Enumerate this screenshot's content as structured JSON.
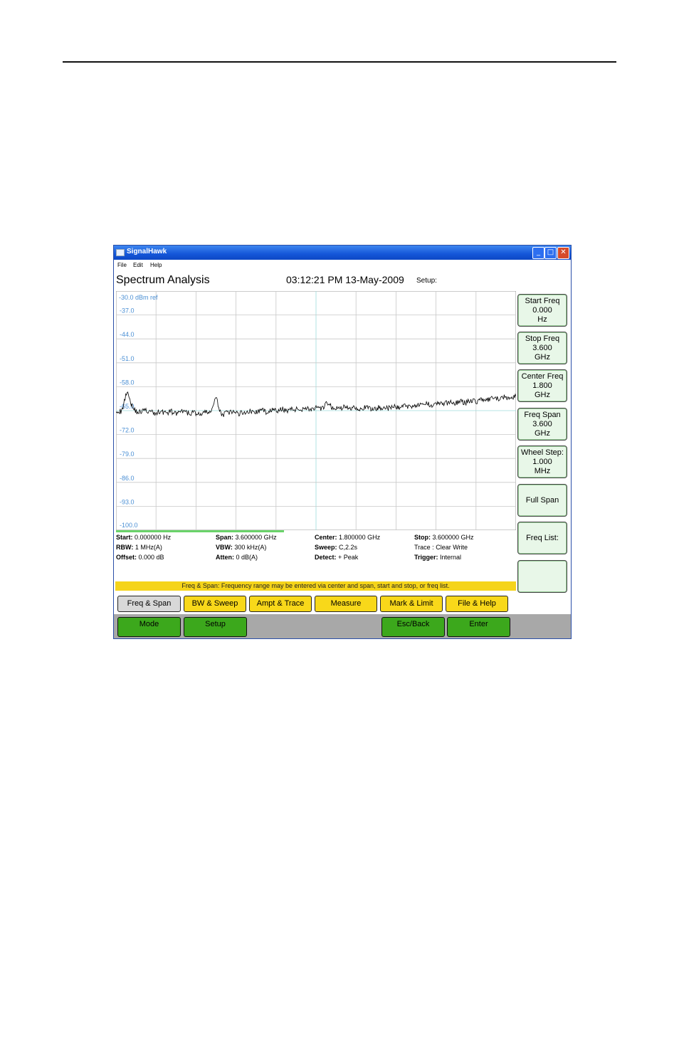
{
  "window": {
    "title": "SignalHawk",
    "controls": {
      "minimize": "_",
      "maximize": "□",
      "close": "✕"
    }
  },
  "menu": {
    "file": "File",
    "edit": "Edit",
    "help": "Help"
  },
  "header": {
    "title": "Spectrum Analysis",
    "datetime": "03:12:21 PM 13-May-2009",
    "setup_label": "Setup:"
  },
  "chart_data": {
    "type": "line",
    "title": "",
    "ref_label": "-30.0 dBm ref",
    "y_tick_labels": [
      "-37.0",
      "-44.0",
      "-51.0",
      "-58.0",
      "-65.0",
      "-72.0",
      "-79.0",
      "-86.0",
      "-93.0",
      "-100.0"
    ],
    "ylim": [
      -100,
      -30
    ],
    "xlim": [
      0,
      3.6
    ],
    "x_unit": "GHz",
    "y_unit": "dBm",
    "grid": true,
    "series": [
      {
        "x": [
          0.0,
          0.05,
          0.1,
          0.15,
          0.2,
          0.25,
          0.3,
          0.35,
          0.4,
          0.45,
          0.5,
          0.55,
          0.6,
          0.65,
          0.7,
          0.75,
          0.8,
          0.85,
          0.9,
          0.95,
          1.0,
          1.05,
          1.1,
          1.15,
          1.2,
          1.25,
          1.3,
          1.35,
          1.4,
          1.45,
          1.5,
          1.55,
          1.6,
          1.65,
          1.7,
          1.75,
          1.8,
          1.85,
          1.9,
          1.95,
          2.0,
          2.05,
          2.1,
          2.15,
          2.2,
          2.25,
          2.3,
          2.35,
          2.4,
          2.45,
          2.5,
          2.55,
          2.6,
          2.65,
          2.7,
          2.75,
          2.8,
          2.85,
          2.9,
          2.95,
          3.0,
          3.05,
          3.1,
          3.15,
          3.2,
          3.25,
          3.3,
          3.35,
          3.4,
          3.45,
          3.5,
          3.55,
          3.6
        ],
        "y": [
          -64.8,
          -65.4,
          -59.0,
          -64.2,
          -65.6,
          -64.9,
          -65.2,
          -65.9,
          -65.1,
          -65.7,
          -65.3,
          -66.0,
          -65.2,
          -65.8,
          -65.5,
          -66.2,
          -65.6,
          -65.4,
          -61.4,
          -66.3,
          -65.7,
          -65.4,
          -65.9,
          -65.5,
          -65.1,
          -65.6,
          -64.9,
          -65.3,
          -64.8,
          -65.2,
          -64.6,
          -64.9,
          -64.5,
          -64.8,
          -64.1,
          -64.6,
          -64.3,
          -64.7,
          -62.8,
          -64.2,
          -64.4,
          -64.0,
          -64.3,
          -63.9,
          -64.5,
          -64.1,
          -64.6,
          -64.2,
          -64.0,
          -64.4,
          -63.8,
          -64.1,
          -63.5,
          -63.9,
          -63.2,
          -63.6,
          -63.0,
          -63.3,
          -62.7,
          -63.1,
          -62.5,
          -62.8,
          -62.3,
          -62.6,
          -62.0,
          -62.3,
          -61.6,
          -62.0,
          -61.3,
          -61.7,
          -61.0,
          -61.4,
          -60.8
        ]
      }
    ]
  },
  "side_buttons": [
    {
      "line1": "Start Freq",
      "line2": "0.000",
      "line3": "Hz"
    },
    {
      "line1": "Stop Freq",
      "line2": "3.600",
      "line3": "GHz"
    },
    {
      "line1": "Center Freq",
      "line2": "1.800",
      "line3": "GHz"
    },
    {
      "line1": "Freq Span",
      "line2": "3.600",
      "line3": "GHz"
    },
    {
      "line1": "Wheel Step:",
      "line2": "1.000",
      "line3": "MHz"
    },
    {
      "line1": "Full Span"
    },
    {
      "line1": "Freq List:"
    },
    {
      "line1": ""
    }
  ],
  "sweep_progress": 0.42,
  "info": {
    "start_label": "Start:",
    "start_value": "0.000000 Hz",
    "span_label": "Span:",
    "span_value": "3.600000 GHz",
    "center_label": "Center:",
    "center_value": "1.800000 GHz",
    "stop_label": "Stop:",
    "stop_value": "3.600000 GHz",
    "rbw_label": "RBW:",
    "rbw_value": "1 MHz(A)",
    "vbw_label": "VBW:",
    "vbw_value": "300 kHz(A)",
    "sweep_label": "Sweep:",
    "sweep_value": "C,2.2s",
    "trace_label": "Trace :",
    "trace_value": "Clear Write",
    "offset_label": "Offset:",
    "offset_value": "0.000 dB",
    "atten_label": "Atten:",
    "atten_value": "0 dB(A)",
    "detect_label": "Detect:",
    "detect_value": "+ Peak",
    "trigger_label": "Trigger:",
    "trigger_value": "Internal"
  },
  "status_message": "Freq & Span: Frequency range may be entered via center and span, start and stop, or freq list.",
  "tabs": [
    "Freq & Span",
    "BW & Sweep",
    "Ampt &  Trace",
    "Measure",
    "Mark & Limit",
    "File & Help"
  ],
  "bottom_buttons": {
    "mode": "Mode",
    "setup": "Setup",
    "esc_back": "Esc/Back",
    "enter": "Enter"
  },
  "colors": {
    "tab_yellow": "#f8d81a",
    "active_tab": "#d8d8d8",
    "softkey_green": "#3ca81c",
    "side_button_bg": "#e8f7e8",
    "grid_line": "#c8c8c8",
    "grid_center": "#9fdcdc",
    "axis_label": "#4a8fd4",
    "trace": "#000000"
  }
}
